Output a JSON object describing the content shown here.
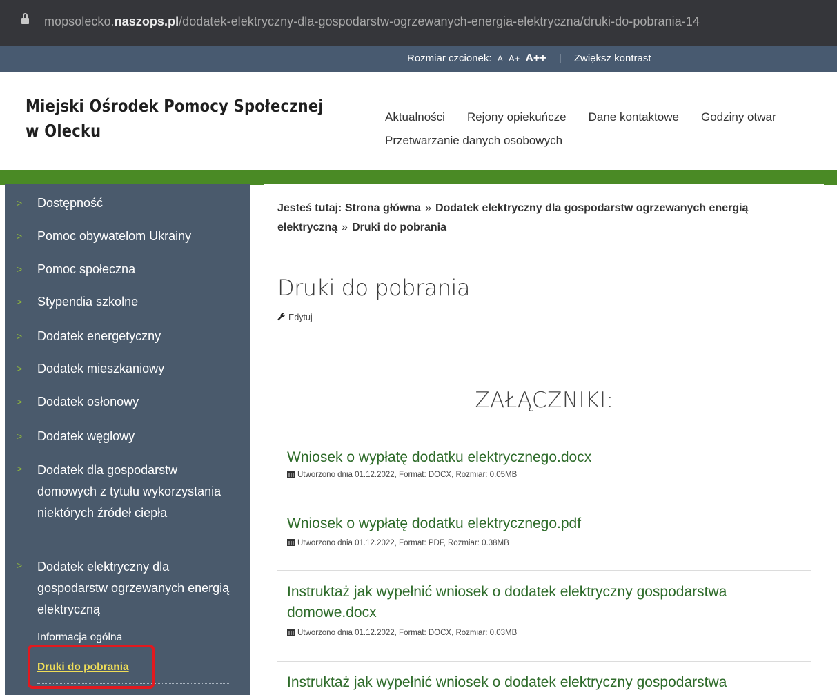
{
  "browser": {
    "url_prefix": "mopsolecko.",
    "url_domain": "naszops.pl",
    "url_path": "/dodatek-elektryczny-dla-gospodarstw-ogrzewanych-energia-elektryczna/druki-do-pobrania-14"
  },
  "accessibility": {
    "font_size_label": "Rozmiar czcionek:",
    "size_a": "A",
    "size_a_plus": "A+",
    "size_a_plus_plus": "A++",
    "separator": "|",
    "contrast_label": "Zwiększ kontrast"
  },
  "header": {
    "logo_line1": "Miejski Ośrodek Pomocy Społecznej",
    "logo_line2": "w Olecku",
    "nav": [
      "Aktualności",
      "Rejony opiekuńcze",
      "Dane kontaktowe",
      "Godziny otwar",
      "Przetwarzanie danych osobowych"
    ]
  },
  "sidebar": {
    "items": [
      "Dostępność",
      "Pomoc obywatelom Ukrainy",
      "Pomoc społeczna",
      "Stypendia szkolne",
      "Dodatek energetyczny",
      "Dodatek mieszkaniowy",
      "Dodatek osłonowy",
      "Dodatek węglowy",
      "Dodatek dla gospodarstw domowych z tytułu wykorzystania niektórych źródeł ciepła",
      "Dodatek elektryczny dla gospodarstw ogrzewanych energią elektryczną"
    ],
    "subitems": [
      "Informacja ogólna",
      "Druki do pobrania"
    ],
    "arrow": ">"
  },
  "content": {
    "breadcrumb_label": "Jesteś tutaj:",
    "breadcrumb": [
      "Strona główna",
      "Dodatek elektryczny dla gospodarstw ogrzewanych energią elektryczną",
      "Druki do pobrania"
    ],
    "breadcrumb_sep": "»",
    "title": "Druki do pobrania",
    "edit_label": "Edytuj",
    "attachments_heading": "ZAŁĄCZNIKI:",
    "attachments": [
      {
        "name": "Wniosek o wypłatę dodatku elektrycznego.docx",
        "meta": "Utworzono dnia 01.12.2022, Format: DOCX, Rozmiar: 0.05MB"
      },
      {
        "name": "Wniosek o wypłatę dodatku elektrycznego.pdf",
        "meta": "Utworzono dnia 01.12.2022, Format: PDF, Rozmiar: 0.38MB"
      },
      {
        "name": "Instruktaż jak wypełnić wniosek o dodatek elektryczny gospodarstwa domowe.docx",
        "meta": "Utworzono dnia 01.12.2022, Format: DOCX, Rozmiar: 0.03MB"
      },
      {
        "name": "Instruktaż jak wypełnić wniosek o dodatek elektryczny gospodarstwa",
        "meta": ""
      }
    ]
  },
  "colors": {
    "brand_green": "#4a8a25",
    "sidebar_bg": "#4a5a6c",
    "link_green": "#2e6b2a",
    "active_yellow": "#f0de58",
    "highlight_red": "#e2191f"
  }
}
